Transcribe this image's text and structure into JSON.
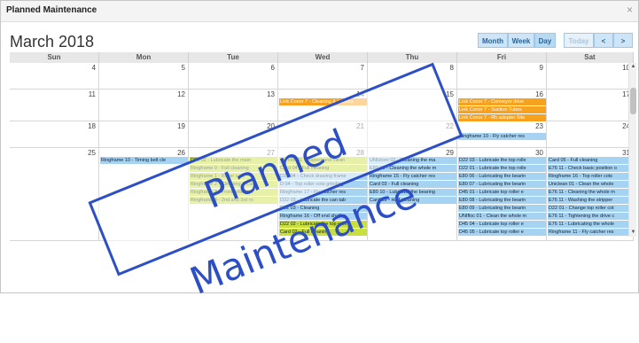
{
  "window": {
    "title": "Planned Maintenance",
    "close_label": "×"
  },
  "header": {
    "month_title": "March 2018"
  },
  "toolbar": {
    "month": "Month",
    "week": "Week",
    "day": "Day",
    "today": "Today",
    "prev": "<",
    "next": ">"
  },
  "weekdays": [
    "Sun",
    "Mon",
    "Tue",
    "Wed",
    "Thu",
    "Fri",
    "Sat"
  ],
  "weeks": [
    {
      "days": [
        "4",
        "5",
        "6",
        "7",
        "8",
        "9",
        "10"
      ]
    },
    {
      "days": [
        "11",
        "12",
        "13",
        "14",
        "15",
        "16",
        "17"
      ]
    },
    {
      "days": [
        "18",
        "19",
        "20",
        "21",
        "22",
        "23",
        "24"
      ]
    },
    {
      "days": [
        "25",
        "26",
        "27",
        "28",
        "29",
        "30",
        "31"
      ]
    }
  ],
  "events": {
    "w2": [
      {
        "text": "Link Conor 7 - Cleaning & Lubrica",
        "color": "orange"
      },
      {
        "text": "Link Conor 7 - Conveyor drive",
        "color": "orange"
      },
      {
        "text": "Link Conor 7 - Suction Tubes",
        "color": "orange"
      },
      {
        "text": "Link Conor 7 - Rh adopter Site",
        "color": "orange"
      }
    ],
    "w3": [
      {
        "text": "Ringframe 10 - Fly catcher res",
        "color": "blue"
      }
    ],
    "w4_mon": [
      {
        "text": "Ringframe 10 - Timing belt cle",
        "color": "blue"
      }
    ],
    "w4_tue": [
      {
        "text": "D25 02 - Lubricate the main",
        "color": "green"
      },
      {
        "text": "Ringframe 0 - Full cleaning",
        "color": "green"
      },
      {
        "text": "Ringframe 1 - Roller cots",
        "color": "green"
      },
      {
        "text": "Ringframe 2 - Cleaning & Lub",
        "color": "green"
      },
      {
        "text": "Ringframe 3 - Front roller gre",
        "color": "green"
      },
      {
        "text": "Ringframe 4 - 2nd and 3rd ro",
        "color": "green"
      }
    ],
    "w4_wed": [
      {
        "text": "Combs 01 - Inspect and clean",
        "color": "green"
      },
      {
        "text": "Card 04 - Full cleaning",
        "color": "green"
      },
      {
        "text": "D22 04 - Check drawing frame",
        "color": "blue"
      },
      {
        "text": "D 04 - Top roller cots grinding",
        "color": "blue"
      },
      {
        "text": "Ringframe 17 - Fly catcher res",
        "color": "blue"
      },
      {
        "text": "D22 03 - Lubricate the can tab",
        "color": "blue"
      },
      {
        "text": "D22 03 - Cleaning",
        "color": "blue"
      },
      {
        "text": "Ringframe 16 - Off end shaft g",
        "color": "blue"
      },
      {
        "text": "D22 02 - Lubricate the top rolle",
        "color": "green"
      },
      {
        "text": "Card 02 - Full cleaning",
        "color": "green"
      }
    ],
    "w4_thu": [
      {
        "text": "UNIstore 02 - Cleaning the ma",
        "color": "blue"
      },
      {
        "text": "E80 10 - Cleaning the whole m",
        "color": "blue"
      },
      {
        "text": "Ringframe 15 - Fly catcher res",
        "color": "blue"
      },
      {
        "text": "Card 03 - Full cleaning",
        "color": "blue"
      },
      {
        "text": "E80 10 - Lubricate the bearing",
        "color": "blue"
      },
      {
        "text": "Card 09 - Half cleaning",
        "color": "blue"
      }
    ],
    "w4_fri": [
      {
        "text": "D22 03 - Lubricate the top rolle",
        "color": "blue"
      },
      {
        "text": "D22 01 - Lubricate the top rolle",
        "color": "blue"
      },
      {
        "text": "E80 06 - Lubricating the bearin",
        "color": "blue"
      },
      {
        "text": "E80 07 - Lubricating the bearin",
        "color": "blue"
      },
      {
        "text": "D45 01 - Lubricate top roller e",
        "color": "blue"
      },
      {
        "text": "E80 08 - Lubricating the bearin",
        "color": "blue"
      },
      {
        "text": "E80 09 - Lubricating the bearin",
        "color": "blue"
      },
      {
        "text": "UNIfloc 01 - Clean the whole m",
        "color": "blue"
      },
      {
        "text": "D45 04 - Lubricate top roller e",
        "color": "blue"
      },
      {
        "text": "D45 05 - Lubricate top roller e",
        "color": "blue"
      }
    ],
    "w4_sat": [
      {
        "text": "Card 05 - Full cleaning",
        "color": "blue"
      },
      {
        "text": "E76 11 - Check basic position o",
        "color": "blue"
      },
      {
        "text": "Ringframe 16 - Top roller cots",
        "color": "blue"
      },
      {
        "text": "Uniclean 01 - Clean the whole",
        "color": "blue"
      },
      {
        "text": "E76 11 - Cleaning the whole m",
        "color": "blue"
      },
      {
        "text": "E76 11 - Washing the stripper",
        "color": "blue"
      },
      {
        "text": "D22 01 - Change top roller cot",
        "color": "blue"
      },
      {
        "text": "E76 11 - Tightening the drive c",
        "color": "blue"
      },
      {
        "text": "E76 11 - Lubricating the whole",
        "color": "blue"
      },
      {
        "text": "Ringframe 11 - Fly catcher res",
        "color": "blue"
      }
    ]
  },
  "watermark": {
    "text": "Planned Maintenance"
  },
  "colors": {
    "blue": "#a7d3f2",
    "green": "#c8df3d",
    "orange": "#f6a21f",
    "watermark": "#2d4fc6"
  }
}
